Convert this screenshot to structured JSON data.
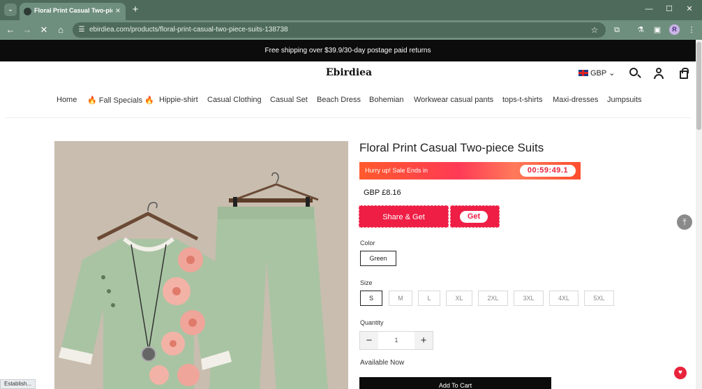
{
  "browser": {
    "tab_title": "Floral Print Casual Two-piece S",
    "url": "ebirdiea.com/products/floral-print-casual-two-piece-suits-138738",
    "profile_initial": "R"
  },
  "announcement": "Free shipping over $39.9/30-day postage paid returns",
  "header": {
    "logo": "Ebirdiea",
    "currency": "GBP"
  },
  "nav": {
    "items": [
      "Home",
      "🔥 Fall Specials 🔥",
      "Hippie-shirt",
      "Casual Clothing",
      "Casual Set",
      "Beach Dress",
      "Bohemian",
      "Workwear casual pants",
      "tops-t-shirts",
      "Maxi-dresses",
      "Jumpsuits"
    ]
  },
  "product": {
    "title": "Floral Print Casual Two-piece Suits",
    "sale_text": "Hurry up! Sale Ends in",
    "timer": "00:59:49.1",
    "price": "GBP £8.16",
    "share_label": "Share & Get",
    "get_label": "Get",
    "color_label": "Color",
    "color_selected": "Green",
    "size_label": "Size",
    "sizes": [
      "S",
      "M",
      "L",
      "XL",
      "2XL",
      "3XL",
      "4XL",
      "5XL"
    ],
    "quantity_label": "Quantity",
    "quantity": "1",
    "availability": "Available Now",
    "add_to_cart": "Add To Cart"
  },
  "status_text": "Establish..."
}
